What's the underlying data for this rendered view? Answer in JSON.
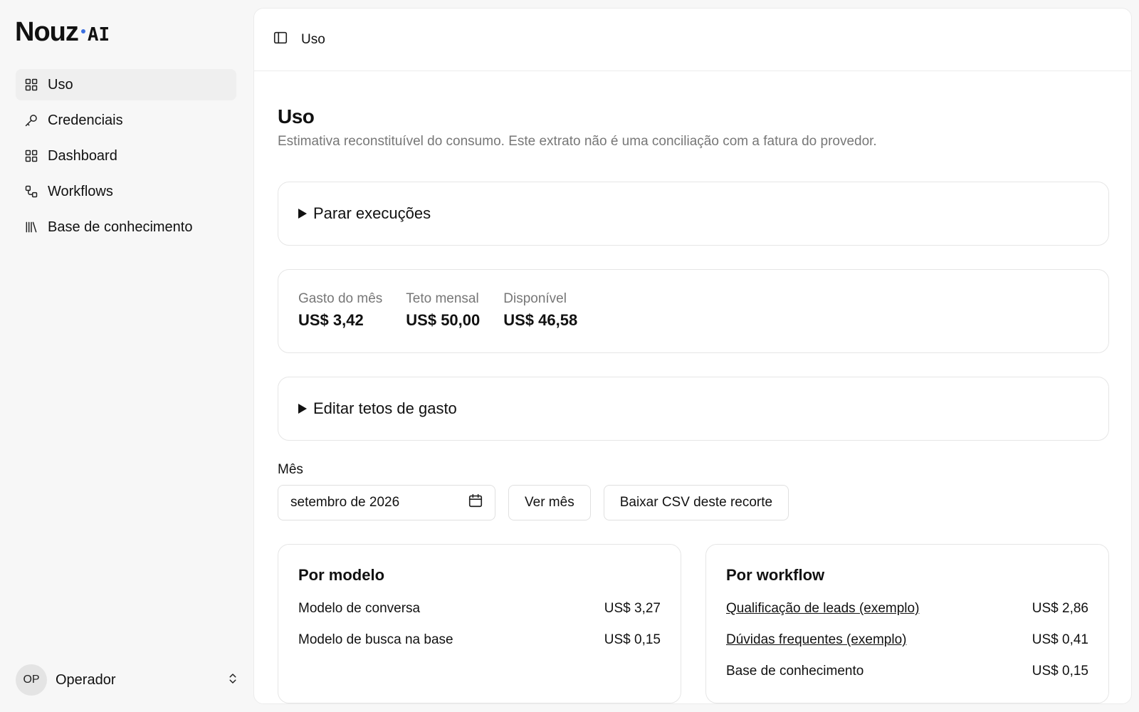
{
  "brand": {
    "name": "Nouz",
    "suffix": "AI",
    "accent": "#3b6fe0"
  },
  "sidebar": {
    "items": [
      {
        "label": "Uso",
        "icon": "grid-icon",
        "active": true
      },
      {
        "label": "Credenciais",
        "icon": "key-icon"
      },
      {
        "label": "Dashboard",
        "icon": "grid-icon"
      },
      {
        "label": "Workflows",
        "icon": "workflow-icon"
      },
      {
        "label": "Base de conhecimento",
        "icon": "library-icon"
      }
    ],
    "user": {
      "initials": "OP",
      "name": "Operador"
    }
  },
  "topbar": {
    "breadcrumb": "Uso"
  },
  "page": {
    "title": "Uso",
    "subtitle": "Estimativa reconstituível do consumo. Este extrato não é uma conciliação com a fatura do provedor."
  },
  "stop_runs": {
    "label": "Parar execuções"
  },
  "stats": [
    {
      "label": "Gasto do mês",
      "value": "US$ 3,42"
    },
    {
      "label": "Teto mensal",
      "value": "US$ 50,00"
    },
    {
      "label": "Disponível",
      "value": "US$ 46,58"
    }
  ],
  "edit_caps": {
    "label": "Editar tetos de gasto"
  },
  "month": {
    "label": "Mês",
    "value": "setembro de 2026",
    "view_button": "Ver mês",
    "csv_button": "Baixar CSV deste recorte"
  },
  "by_model": {
    "title": "Por modelo",
    "rows": [
      {
        "name": "Modelo de conversa",
        "value": "US$ 3,27"
      },
      {
        "name": "Modelo de busca na base",
        "value": "US$ 0,15"
      }
    ]
  },
  "by_workflow": {
    "title": "Por workflow",
    "rows": [
      {
        "name": "Qualificação de leads (exemplo)",
        "value": "US$ 2,86",
        "link": true
      },
      {
        "name": "Dúvidas frequentes (exemplo)",
        "value": "US$ 0,41",
        "link": true
      },
      {
        "name": "Base de conhecimento",
        "value": "US$ 0,15",
        "link": false
      }
    ]
  }
}
